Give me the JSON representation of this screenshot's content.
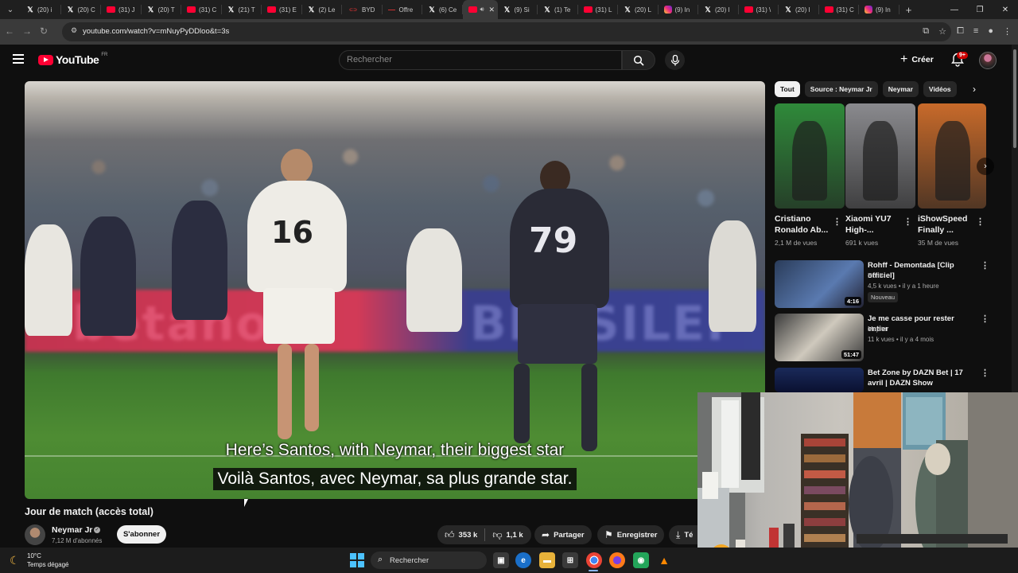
{
  "browser": {
    "tabs": [
      {
        "icon": "x",
        "label": "(20) i"
      },
      {
        "icon": "x",
        "label": "(20) C"
      },
      {
        "icon": "yt",
        "label": "(31) J"
      },
      {
        "icon": "x",
        "label": "(20) T"
      },
      {
        "icon": "yt",
        "label": "(31) C"
      },
      {
        "icon": "x",
        "label": "(21) T"
      },
      {
        "icon": "yt",
        "label": "(31) E"
      },
      {
        "icon": "x",
        "label": "(2) Le"
      },
      {
        "icon": "byd",
        "label": "BYD"
      },
      {
        "icon": "other",
        "label": "Offre"
      },
      {
        "icon": "x",
        "label": "(6) Ce"
      },
      {
        "icon": "yt",
        "label": "",
        "active": true
      },
      {
        "icon": "x",
        "label": "(9) Si"
      },
      {
        "icon": "x",
        "label": "(1) Te"
      },
      {
        "icon": "yt",
        "label": "(31) L"
      },
      {
        "icon": "x",
        "label": "(20) L"
      },
      {
        "icon": "ig",
        "label": "(9) In"
      },
      {
        "icon": "x",
        "label": "(20) I"
      },
      {
        "icon": "yt",
        "label": "(31) \\"
      },
      {
        "icon": "x",
        "label": "(20) I"
      },
      {
        "icon": "yt",
        "label": "(31) C"
      },
      {
        "icon": "ig",
        "label": "(9) In"
      }
    ],
    "new_tab": "+",
    "url": "youtube.com/watch?v=mNuyPyDDloo&t=3s"
  },
  "youtube": {
    "logo_word": "YouTube",
    "country": "FR",
    "search_placeholder": "Rechercher",
    "create_label": "Créer",
    "notifications_badge": "9+"
  },
  "video": {
    "subtitle_en": "Here’s Santos, with Neymar, their biggest star",
    "subtitle_fr": "Voilà Santos, avec Neymar, sa plus grande star.",
    "jersey_a": "16",
    "jersey_b": "79",
    "title": "Jour de match (accès total)",
    "channel": "Neymar Jr",
    "subscribers": "7,12 M d'abonnés",
    "subscribe_label": "S'abonner",
    "likes": "353 k",
    "dislikes": "1,1 k",
    "share_label": "Partager",
    "save_label": "Enregistrer",
    "download_label": "Té"
  },
  "sidebar": {
    "chips": [
      "Tout",
      "Source : Neymar Jr",
      "Neymar",
      "Vidéos"
    ],
    "shorts": [
      {
        "title": "Cristiano Ronaldo Ab...",
        "views": "2,1 M de vues",
        "thumb_color": "#2f8a3a"
      },
      {
        "title": "Xiaomi YU7 High-...",
        "views": "691 k vues",
        "thumb_color": "#8a8a8e"
      },
      {
        "title": "iShowSpeed Finally ...",
        "views": "35 M de vues",
        "thumb_color": "#c86a2a"
      }
    ],
    "recommended": [
      {
        "title": "Rohff - Demontada [Clip officiel]",
        "channel": "Rohff",
        "meta": "4,5 k vues • il y a 1 heure",
        "badge": "Nouveau",
        "duration": "4:16"
      },
      {
        "title": "Je me casse pour rester entier",
        "channel": "Majster",
        "meta": "11 k vues • il y a 4 mois",
        "badge": "",
        "duration": "51:47"
      },
      {
        "title": "Bet Zone by DAZN Bet | 17 avril | DAZN Show",
        "channel": "",
        "meta": "",
        "badge": "",
        "duration": ""
      }
    ]
  },
  "taskbar": {
    "weather_temp": "10°C",
    "weather_desc": "Temps dégagé",
    "search_label": "Rechercher"
  }
}
